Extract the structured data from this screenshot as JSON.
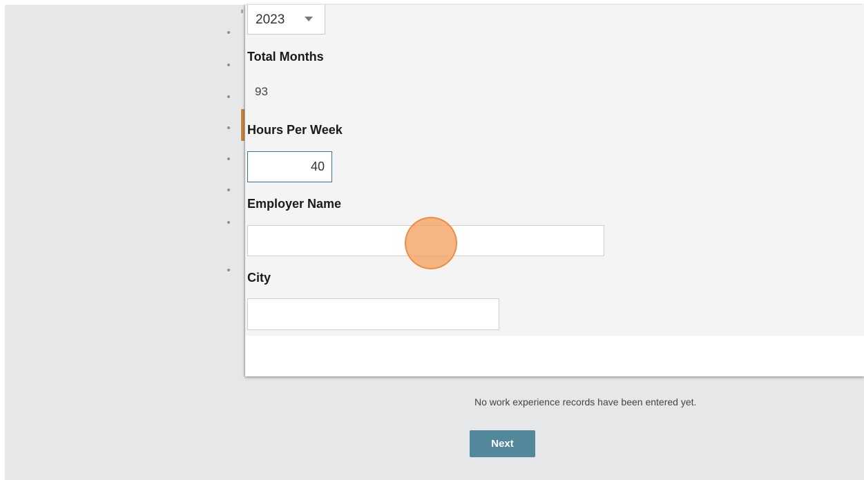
{
  "form": {
    "year_select": {
      "value": "2023"
    },
    "total_months": {
      "label": "Total Months",
      "value": "93"
    },
    "hours_per_week": {
      "label": "Hours Per Week",
      "value": "40"
    },
    "employer_name": {
      "label": "Employer Name",
      "value": ""
    },
    "city": {
      "label": "City",
      "value": ""
    }
  },
  "records": {
    "empty_message": "No work experience records have been entered yet."
  },
  "actions": {
    "next_label": "Next"
  },
  "colors": {
    "accent_marker": "#c8823f",
    "next_button": "#53879c",
    "click_indicator": "#f5a05f",
    "input_focus_border": "#3f6f8f"
  },
  "icons": {
    "select_caret": "caret-down-icon"
  }
}
